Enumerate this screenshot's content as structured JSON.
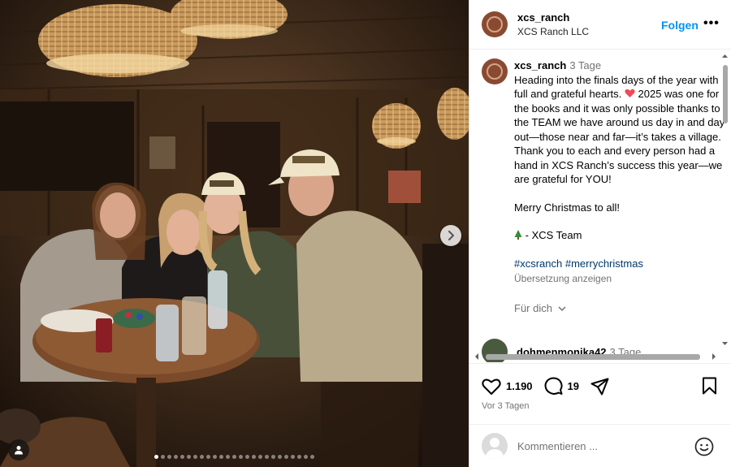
{
  "post": {
    "username": "xcs_ranch",
    "subtitle": "XCS Ranch LLC",
    "follow_label": "Folgen",
    "more_label": "•••"
  },
  "caption": {
    "username": "xcs_ranch",
    "time": "3 Tage",
    "line_before_heart": "Heading into the finals days of the year with full and grateful hearts.",
    "heart_icon": "red-heart-emoji",
    "line_after_heart": "2025 was one for the books and it was only possible thanks to the TEAM we have around us day in and day out—those near and far—it’s takes a village. Thank you to each and every person had a hand in XCS Ranch’s success this year—we are grateful for YOU!",
    "greeting": "Merry Christmas to all!",
    "tree_icon": "christmas-tree-emoji",
    "signature": "- XCS Team",
    "hashtag1": "#xcsranch",
    "hashtag2": "#merrychristmas",
    "translate_label": "Übersetzung anzeigen",
    "for_you_label": "Für dich"
  },
  "comment_preview": {
    "username": "dohmenmonika42",
    "time": "3 Tage"
  },
  "actions": {
    "likes": "1.190",
    "comments": "19",
    "date": "Vor 3 Tagen"
  },
  "comment_input": {
    "placeholder": "Kommentieren ..."
  },
  "carousel": {
    "slide_count": 25,
    "active_index": 0
  },
  "colors": {
    "accent": "#0095f6",
    "heart": "#ed4956",
    "hashtag": "#00376b"
  }
}
